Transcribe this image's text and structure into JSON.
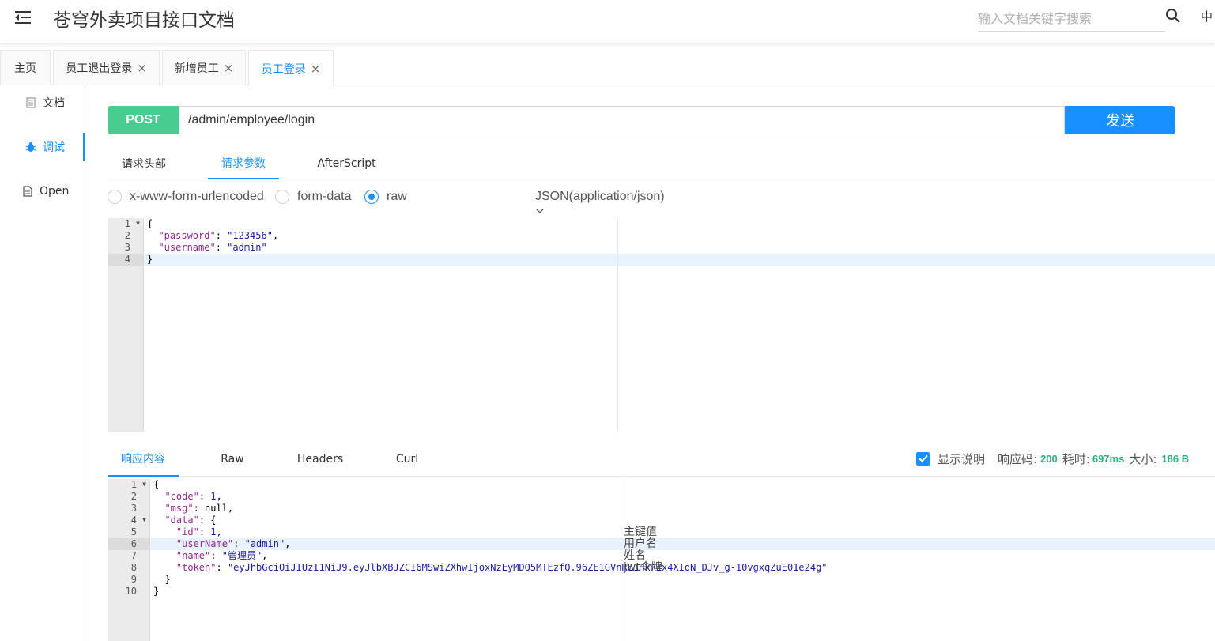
{
  "header": {
    "title": "苍穹外卖项目接口文档",
    "search_placeholder": "输入文档关键字搜索",
    "lang_label": "中"
  },
  "tabs": [
    {
      "label": "主页"
    },
    {
      "label": "员工退出登录"
    },
    {
      "label": "新增员工"
    },
    {
      "label": "员工登录"
    }
  ],
  "tab_close": "×",
  "leftnav": {
    "items": [
      {
        "label": "文档",
        "icon": "document-icon"
      },
      {
        "label": "调试",
        "icon": "bug-icon"
      },
      {
        "label": "Open",
        "icon": "file-icon"
      }
    ]
  },
  "request": {
    "method": "POST",
    "url": "/admin/employee/login",
    "send_label": "发送",
    "tabs": [
      {
        "label": "请求头部"
      },
      {
        "label": "请求参数"
      },
      {
        "label": "AfterScript"
      }
    ],
    "body_types": [
      {
        "label": "x-www-form-urlencoded"
      },
      {
        "label": "form-data"
      },
      {
        "label": "raw"
      }
    ],
    "content_type": "JSON(application/json)",
    "body_lines": [
      "1",
      "2",
      "3",
      "4"
    ]
  },
  "response": {
    "tabs": [
      {
        "label": "响应内容"
      },
      {
        "label": "Raw"
      },
      {
        "label": "Headers"
      },
      {
        "label": "Curl"
      }
    ],
    "show_desc_label": "显示说明",
    "status_label": "响应码:",
    "status_value": "200",
    "time_label": "耗时:",
    "time_value": "697ms",
    "size_label": "大小:",
    "size_value": "186 B",
    "line_numbers": [
      "1",
      "2",
      "3",
      "4",
      "5",
      "6",
      "7",
      "8",
      "9",
      "10"
    ],
    "comments": {
      "id": "主键值",
      "userName": "用户名",
      "name": "姓名",
      "token": "jwt令牌"
    }
  },
  "colors": {
    "accent": "#1890ff",
    "post_method": "#49cc90",
    "status_green": "#2ab27b"
  }
}
